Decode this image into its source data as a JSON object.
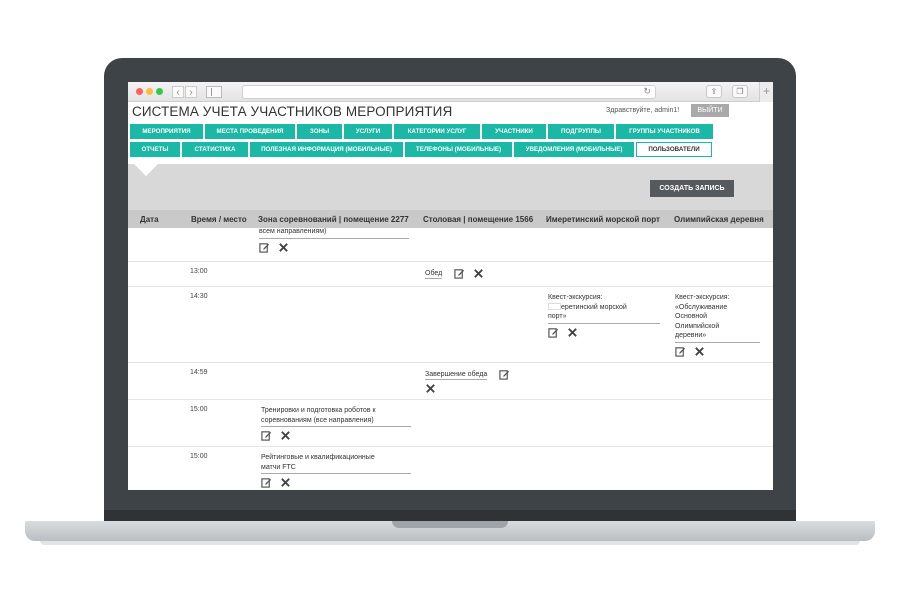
{
  "header": {
    "title": "СИСТЕМА УЧЕТА УЧАСТНИКОВ МЕРОПРИЯТИЯ",
    "greeting": "Здравствуйте, admin1!",
    "logout_label": "ВЫЙТИ"
  },
  "menu_row1": [
    {
      "label": "МЕРОПРИЯТИЯ",
      "name": "menu-events"
    },
    {
      "label": "МЕСТА ПРОВЕДЕНИЯ",
      "name": "menu-venues"
    },
    {
      "label": "ЗОНЫ",
      "name": "menu-zones"
    },
    {
      "label": "УСЛУГИ",
      "name": "menu-services"
    },
    {
      "label": "КАТЕГОРИИ УСЛУГ",
      "name": "menu-service-categories"
    },
    {
      "label": "УЧАСТНИКИ",
      "name": "menu-participants"
    },
    {
      "label": "ПОДГРУППЫ",
      "name": "menu-subgroups"
    },
    {
      "label": "ГРУППЫ УЧАСТНИКОВ",
      "name": "menu-participant-groups"
    }
  ],
  "menu_row2": [
    {
      "label": "ОТЧЕТЫ",
      "name": "menu-reports"
    },
    {
      "label": "СТАТИСТИКА",
      "name": "menu-statistics"
    },
    {
      "label": "ПОЛЕЗНАЯ ИНФОРМАЦИЯ (МОБИЛЬНЫЕ)",
      "name": "menu-useful-info"
    },
    {
      "label": "ТЕЛЕФОНЫ (МОБИЛЬНЫЕ)",
      "name": "menu-phones"
    },
    {
      "label": "УВЕДОМЛЕНИЯ (МОБИЛЬНЫЕ)",
      "name": "menu-notifications"
    },
    {
      "label": "ПОЛЬЗОВАТЕЛИ",
      "name": "menu-users",
      "active": true
    }
  ],
  "create_label": "СОЗДАТЬ ЗАПИСЬ",
  "table": {
    "columns": [
      "Дата",
      "Время / место",
      "Зона соревнований | помещение 2277",
      "Столовая | помещение 1566",
      "Имеретинский морской порт",
      "Олимпийская деревня"
    ],
    "rows": [
      {
        "time": "",
        "zone": "всем направлениям)"
      },
      {
        "time": "13:00",
        "canteen": "Обед"
      },
      {
        "time": "14:30",
        "port_suffix": "еретинский морской",
        "port_line1": "Квест-экскурсия:",
        "port_line3": "порт»",
        "village": [
          "Квест-экскурсия:",
          "«Обслуживание",
          "Основной",
          "Олимпийской",
          "деревни»"
        ]
      },
      {
        "time": "14:59",
        "canteen": "Завершение обеда"
      },
      {
        "time": "15:00",
        "zone": [
          "Тренировки и подготовка роботов к",
          "соревнованиям (все направления)"
        ]
      },
      {
        "time": "15:00",
        "zone": [
          "Рейтинговые и квалификационные",
          "матчи FTC"
        ]
      }
    ]
  },
  "colors": {
    "accent": "#1bb9a5",
    "logout_bg": "#a9a9a9",
    "create_bg": "#555a5e",
    "header_bg": "#c9c9c9"
  }
}
